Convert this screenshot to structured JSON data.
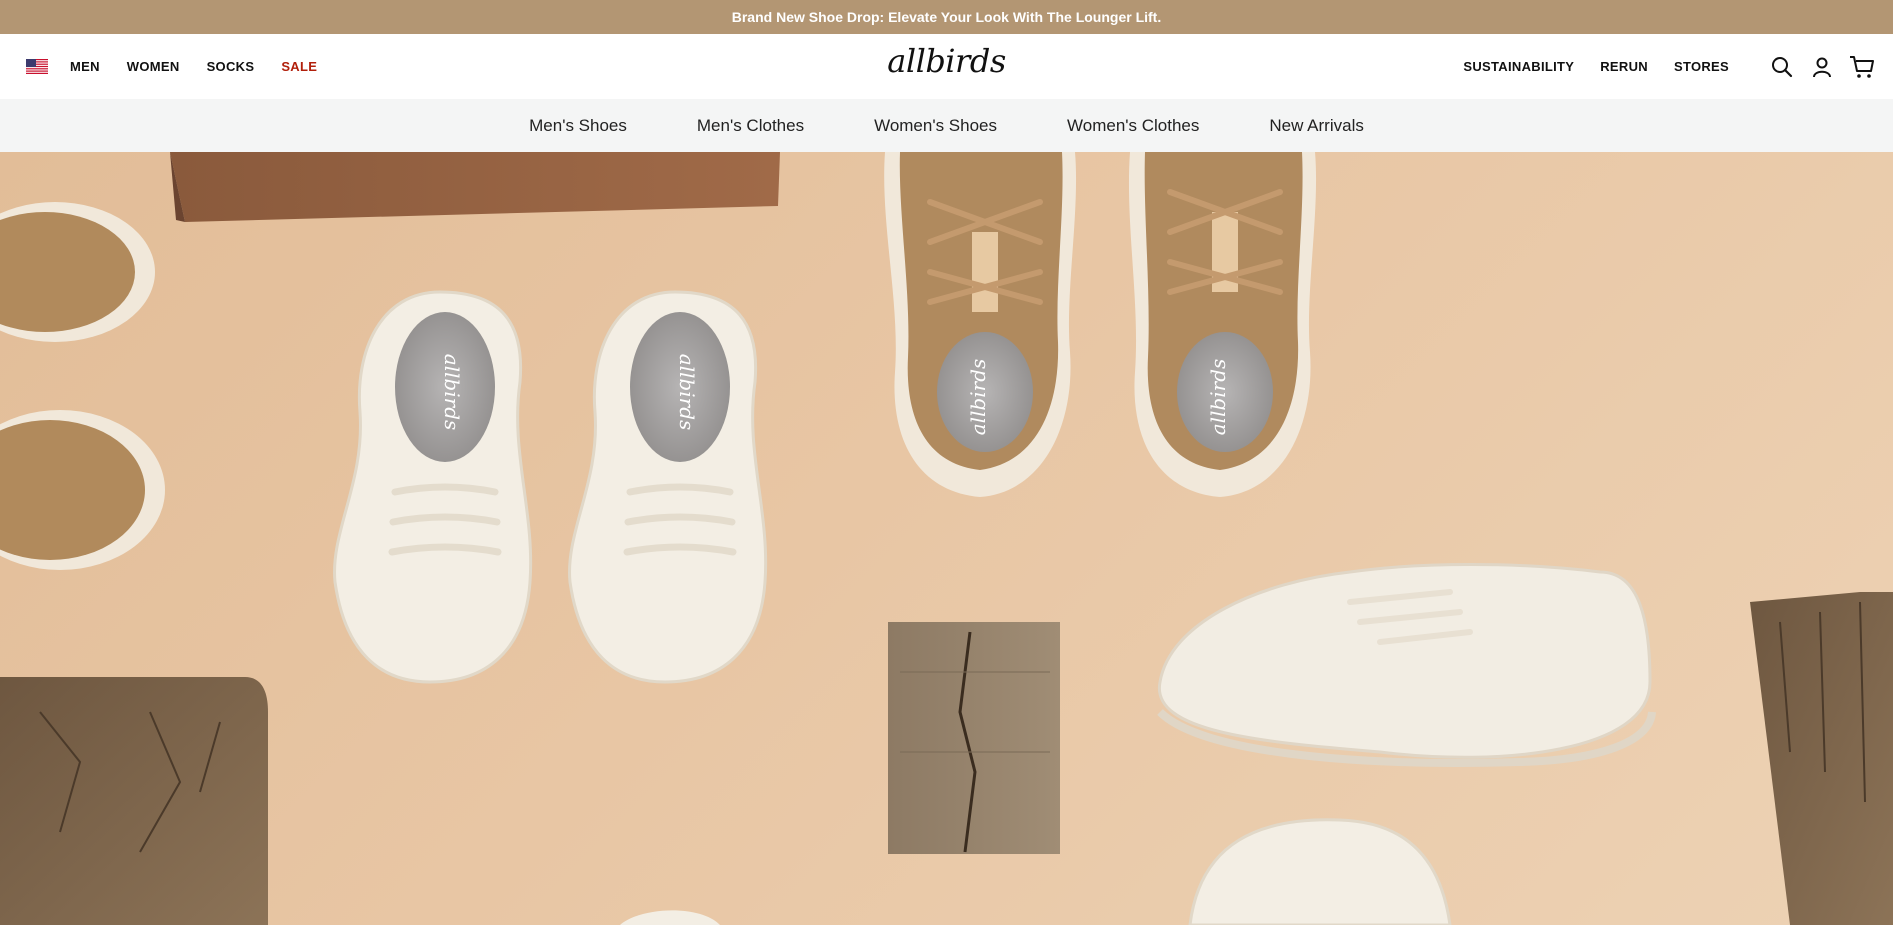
{
  "announcement": {
    "text": "Brand New Shoe Drop: Elevate Your Look With The Lounger Lift."
  },
  "header": {
    "logo": "allbirds",
    "left_nav": [
      "MEN",
      "WOMEN",
      "SOCKS",
      "SALE"
    ],
    "right_nav": [
      "SUSTAINABILITY",
      "RERUN",
      "STORES"
    ],
    "icons": [
      "search-icon",
      "account-icon",
      "cart-icon"
    ],
    "colors": {
      "sale": "#b11f0b",
      "announcement_bg": "#b39673"
    }
  },
  "subnav": [
    "Men's Shoes",
    "Men's Clothes",
    "Women's Shoes",
    "Women's Clothes",
    "New Arrivals"
  ],
  "hero": {
    "insole_brand": "allbirds"
  }
}
